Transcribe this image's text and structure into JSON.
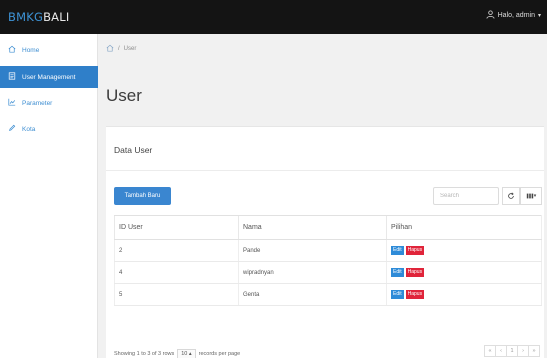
{
  "brand": {
    "part1": "BMKG",
    "part2": "BALI"
  },
  "topbar": {
    "user_label": "Halo, admin",
    "caret": "▾"
  },
  "sidebar": {
    "items": [
      {
        "label": "Home",
        "icon": "home-icon"
      },
      {
        "label": "User Management",
        "icon": "users-icon",
        "active": true
      },
      {
        "label": "Parameter",
        "icon": "chart-icon"
      },
      {
        "label": "Kota",
        "icon": "pencil-icon"
      }
    ]
  },
  "breadcrumb": {
    "current": "User"
  },
  "page": {
    "title": "User"
  },
  "card": {
    "title": "Data User"
  },
  "toolbar": {
    "add_label": "Tambah Baru",
    "search_placeholder": "Search",
    "columns_caret": "▾"
  },
  "table": {
    "headers": [
      "ID User",
      "Nama",
      "Pilihan"
    ],
    "rows": [
      {
        "id": "2",
        "name": "Pande"
      },
      {
        "id": "4",
        "name": "wipradnyan"
      },
      {
        "id": "5",
        "name": "Genta"
      }
    ],
    "edit_label": "Edit",
    "delete_label": "Hapus"
  },
  "footer": {
    "showing_text": "Showing 1 to 3 of 3 rows",
    "page_size": "10",
    "page_size_caret": "▴",
    "per_page_text": "records per page"
  },
  "pager": {
    "first": "«",
    "prev": "‹",
    "current": "1",
    "next": "›",
    "last": "»"
  },
  "colors": {
    "topbar": "#141414",
    "accent": "#3a86d0",
    "danger": "#e0243a",
    "active_nav": "#2f7fc9"
  }
}
